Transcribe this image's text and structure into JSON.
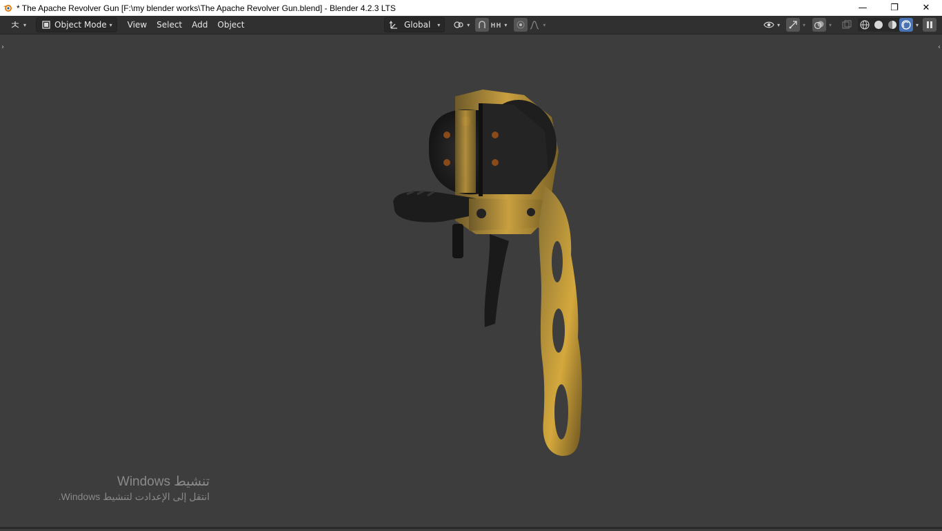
{
  "window": {
    "title": "* The Apache Revolver Gun [F:\\my blender works\\The Apache Revolver Gun.blend] - Blender 4.2.3 LTS",
    "controls": {
      "minimize": "—",
      "restore": "❐",
      "close": "✕"
    }
  },
  "header": {
    "editor_type_icon": "editor-type-icon",
    "mode_label": "Object Mode",
    "menus": [
      "View",
      "Select",
      "Add",
      "Object"
    ],
    "transform_orientation": "Global",
    "icons": {
      "orientation": "transform-orientation-icon",
      "pivot": "pivot-point-icon",
      "snap": "snap-icon",
      "snap_target": "snap-increment-icon",
      "proportional": "proportional-editing-icon",
      "falloff": "falloff-curve-icon",
      "visibility": "object-visibility-icon",
      "gizmo": "gizmo-icon",
      "overlays": "overlays-icon",
      "xray": "xray-icon",
      "shading_wire": "wireframe-shading-icon",
      "shading_solid": "solid-shading-icon",
      "shading_material": "material-preview-icon",
      "shading_rendered": "rendered-shading-icon",
      "pause": "pause-render-icon"
    },
    "accent": "#4772b3"
  },
  "viewport": {
    "background": "#3d3d3d",
    "object": "revolver-model"
  },
  "watermark": {
    "line1": "تنشيط Windows",
    "line2": "انتقل إلى الإعدادت لتنشيط Windows."
  }
}
